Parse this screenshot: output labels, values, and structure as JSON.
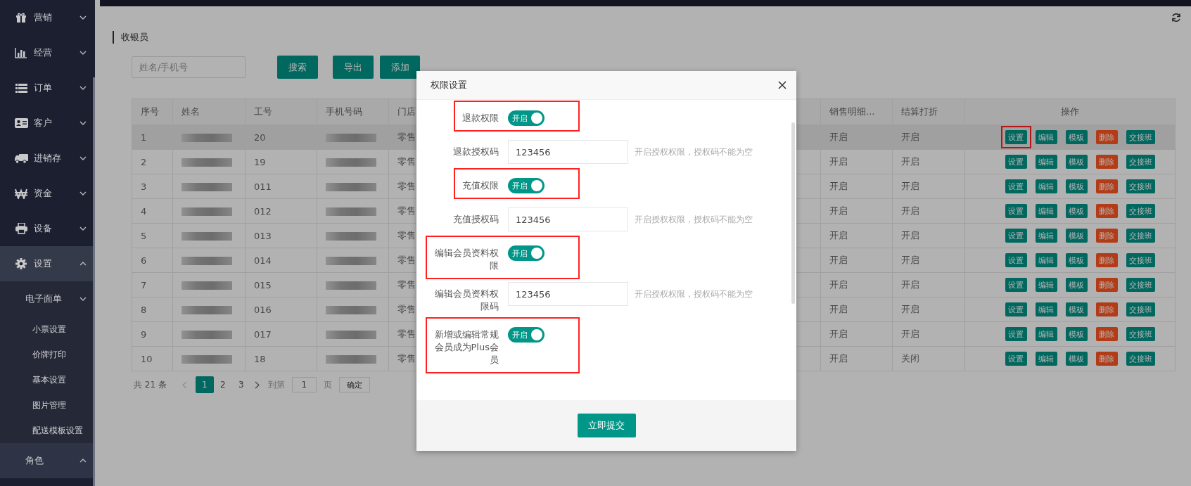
{
  "sidebar": {
    "items": [
      {
        "label": "营销",
        "expanded": false
      },
      {
        "label": "经营",
        "expanded": false
      },
      {
        "label": "订单",
        "expanded": false
      },
      {
        "label": "客户",
        "expanded": false
      },
      {
        "label": "进销存",
        "expanded": false
      },
      {
        "label": "资金",
        "expanded": false
      },
      {
        "label": "设备",
        "expanded": false
      },
      {
        "label": "设置",
        "expanded": true,
        "children": [
          {
            "label": "电子面单",
            "expanded": false,
            "children": [
              {
                "label": "小票设置"
              },
              {
                "label": "价牌打印"
              },
              {
                "label": "基本设置"
              },
              {
                "label": "图片管理"
              },
              {
                "label": "配送模板设置"
              }
            ]
          },
          {
            "label": "角色",
            "expanded": true
          }
        ]
      }
    ]
  },
  "page": {
    "title": "收银员",
    "search": {
      "placeholder": "姓名/手机号"
    },
    "buttons": [
      "搜索",
      "导出",
      "添加"
    ]
  },
  "table": {
    "columns": [
      "序号",
      "姓名",
      "工号",
      "手机号码",
      "门店",
      "销售明细...",
      "结算打折",
      "操作"
    ],
    "rows": [
      {
        "no": "1",
        "employee_no": "20",
        "store": "零售",
        "sales_detail": "开启",
        "settle_discount": "开启",
        "selected": true,
        "actions": [
          {
            "label": "设置",
            "kind": "primary",
            "highlighted": true
          },
          {
            "label": "编辑",
            "kind": "primary",
            "highlighted": false
          },
          {
            "label": "模板",
            "kind": "primary",
            "highlighted": false
          },
          {
            "label": "删除",
            "kind": "danger",
            "highlighted": false
          },
          {
            "label": "交接班",
            "kind": "primary",
            "highlighted": false
          }
        ]
      },
      {
        "no": "2",
        "employee_no": "19",
        "store": "零售",
        "sales_detail": "开启",
        "settle_discount": "开启",
        "selected": false,
        "actions": [
          {
            "label": "设置",
            "kind": "primary",
            "highlighted": false
          },
          {
            "label": "编辑",
            "kind": "primary",
            "highlighted": false
          },
          {
            "label": "模板",
            "kind": "primary",
            "highlighted": false
          },
          {
            "label": "删除",
            "kind": "danger",
            "highlighted": false
          },
          {
            "label": "交接班",
            "kind": "primary",
            "highlighted": false
          }
        ]
      },
      {
        "no": "3",
        "employee_no": "011",
        "store": "零售",
        "sales_detail": "开启",
        "settle_discount": "开启",
        "selected": false,
        "actions": [
          {
            "label": "设置",
            "kind": "primary",
            "highlighted": false
          },
          {
            "label": "编辑",
            "kind": "primary",
            "highlighted": false
          },
          {
            "label": "模板",
            "kind": "primary",
            "highlighted": false
          },
          {
            "label": "删除",
            "kind": "danger",
            "highlighted": false
          },
          {
            "label": "交接班",
            "kind": "primary",
            "highlighted": false
          }
        ]
      },
      {
        "no": "4",
        "employee_no": "012",
        "store": "零售",
        "sales_detail": "开启",
        "settle_discount": "开启",
        "selected": false,
        "actions": [
          {
            "label": "设置",
            "kind": "primary",
            "highlighted": false
          },
          {
            "label": "编辑",
            "kind": "primary",
            "highlighted": false
          },
          {
            "label": "模板",
            "kind": "primary",
            "highlighted": false
          },
          {
            "label": "删除",
            "kind": "danger",
            "highlighted": false
          },
          {
            "label": "交接班",
            "kind": "primary",
            "highlighted": false
          }
        ]
      },
      {
        "no": "5",
        "employee_no": "013",
        "store": "零售",
        "sales_detail": "开启",
        "settle_discount": "开启",
        "selected": false,
        "actions": [
          {
            "label": "设置",
            "kind": "primary",
            "highlighted": false
          },
          {
            "label": "编辑",
            "kind": "primary",
            "highlighted": false
          },
          {
            "label": "模板",
            "kind": "primary",
            "highlighted": false
          },
          {
            "label": "删除",
            "kind": "danger",
            "highlighted": false
          },
          {
            "label": "交接班",
            "kind": "primary",
            "highlighted": false
          }
        ]
      },
      {
        "no": "6",
        "employee_no": "014",
        "store": "零售",
        "sales_detail": "开启",
        "settle_discount": "开启",
        "selected": false,
        "actions": [
          {
            "label": "设置",
            "kind": "primary",
            "highlighted": false
          },
          {
            "label": "编辑",
            "kind": "primary",
            "highlighted": false
          },
          {
            "label": "模板",
            "kind": "primary",
            "highlighted": false
          },
          {
            "label": "删除",
            "kind": "danger",
            "highlighted": false
          },
          {
            "label": "交接班",
            "kind": "primary",
            "highlighted": false
          }
        ]
      },
      {
        "no": "7",
        "employee_no": "015",
        "store": "零售",
        "sales_detail": "开启",
        "settle_discount": "开启",
        "selected": false,
        "actions": [
          {
            "label": "设置",
            "kind": "primary",
            "highlighted": false
          },
          {
            "label": "编辑",
            "kind": "primary",
            "highlighted": false
          },
          {
            "label": "模板",
            "kind": "primary",
            "highlighted": false
          },
          {
            "label": "删除",
            "kind": "danger",
            "highlighted": false
          },
          {
            "label": "交接班",
            "kind": "primary",
            "highlighted": false
          }
        ]
      },
      {
        "no": "8",
        "employee_no": "016",
        "store": "零售",
        "sales_detail": "开启",
        "settle_discount": "开启",
        "selected": false,
        "actions": [
          {
            "label": "设置",
            "kind": "primary",
            "highlighted": false
          },
          {
            "label": "编辑",
            "kind": "primary",
            "highlighted": false
          },
          {
            "label": "模板",
            "kind": "primary",
            "highlighted": false
          },
          {
            "label": "删除",
            "kind": "danger",
            "highlighted": false
          },
          {
            "label": "交接班",
            "kind": "primary",
            "highlighted": false
          }
        ]
      },
      {
        "no": "9",
        "employee_no": "017",
        "store": "零售",
        "sales_detail": "开启",
        "settle_discount": "开启",
        "selected": false,
        "actions": [
          {
            "label": "设置",
            "kind": "primary",
            "highlighted": false
          },
          {
            "label": "编辑",
            "kind": "primary",
            "highlighted": false
          },
          {
            "label": "模板",
            "kind": "primary",
            "highlighted": false
          },
          {
            "label": "删除",
            "kind": "danger",
            "highlighted": false
          },
          {
            "label": "交接班",
            "kind": "primary",
            "highlighted": false
          }
        ]
      },
      {
        "no": "10",
        "employee_no": "18",
        "store": "零售",
        "sales_detail": "开启",
        "settle_discount": "关闭",
        "selected": false,
        "actions": [
          {
            "label": "设置",
            "kind": "primary",
            "highlighted": false
          },
          {
            "label": "编辑",
            "kind": "primary",
            "highlighted": false
          },
          {
            "label": "模板",
            "kind": "primary",
            "highlighted": false
          },
          {
            "label": "删除",
            "kind": "danger",
            "highlighted": false
          },
          {
            "label": "交接班",
            "kind": "primary",
            "highlighted": false
          }
        ]
      }
    ]
  },
  "pagination": {
    "total": "共 21 条",
    "pages": [
      {
        "label": "1",
        "selected": true
      },
      {
        "label": "2",
        "selected": false
      },
      {
        "label": "3",
        "selected": false
      }
    ],
    "goto_label": "到第",
    "goto_value": "1",
    "page_unit": "页",
    "confirm": "确定"
  },
  "dialog": {
    "title": "权限设置",
    "fields": [
      {
        "kind": "toggle",
        "label": "退款权限",
        "on": true,
        "toggle_text": "开启",
        "highlighted": true
      },
      {
        "kind": "input",
        "label": "退款授权码",
        "value": "123456",
        "hint": "开启授权权限，授权码不能为空"
      },
      {
        "kind": "toggle",
        "label": "充值权限",
        "on": true,
        "toggle_text": "开启",
        "highlighted": true
      },
      {
        "kind": "input",
        "label": "充值授权码",
        "value": "123456",
        "hint": "开启授权权限，授权码不能为空"
      },
      {
        "kind": "toggle",
        "label": "编辑会员资料权限",
        "on": true,
        "toggle_text": "开启",
        "highlighted": true
      },
      {
        "kind": "input",
        "label": "编辑会员资料权限码",
        "value": "123456",
        "hint": "开启授权权限，授权码不能为空"
      },
      {
        "kind": "toggle",
        "label": "新增或编辑常规会员成为Plus会员",
        "on": true,
        "toggle_text": "开启",
        "highlighted": true
      }
    ],
    "submit": "立即提交"
  }
}
